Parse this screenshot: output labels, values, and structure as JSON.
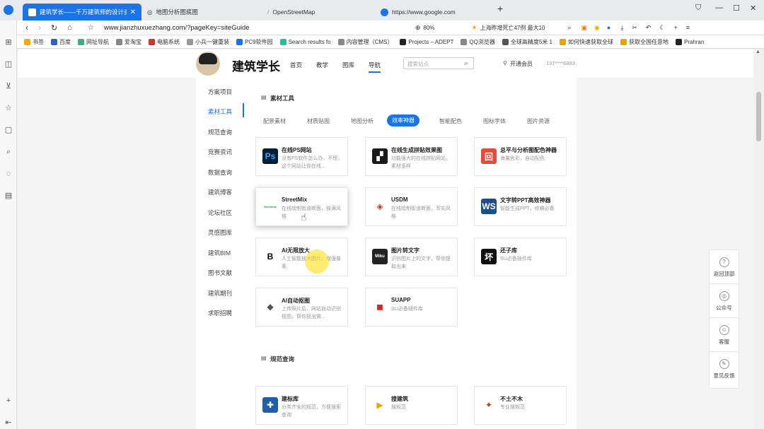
{
  "tabs": [
    {
      "label": "建筑学长——千万建筑师的设计资源",
      "active": true
    },
    {
      "label": "地图分析图底图",
      "active": false
    },
    {
      "label": "OpenStreetMap",
      "active": false
    },
    {
      "label": "https://www.google.com",
      "active": false
    }
  ],
  "new_tab": "+",
  "address": {
    "url": "www.jianzhuxuezhang.com/?pageKey=siteGuide",
    "zoom": "80%",
    "weather": "上海昨增死亡47例 最大10"
  },
  "bookmarks": [
    "书签",
    "百度",
    "网址导航",
    "爱淘宝",
    "电脑系统",
    "小兵一键重装",
    "PC9软件园",
    "Search results fo",
    "内容管理（CMS）",
    "Projects – ADEPT",
    "QQ浏览器",
    "全球高精度5米 1",
    "如何快速获取全球",
    "获取全国任意地",
    "Prahran"
  ],
  "header": {
    "logo": "建筑学长",
    "nav": [
      "首页",
      "教学",
      "图库",
      "导航"
    ],
    "search_placeholder": "搜索站点",
    "vip": "开通会员",
    "phone": "137****6893"
  },
  "sidenav": [
    "方案项目",
    "素材工具",
    "规范查询",
    "竞赛资讯",
    "数据查询",
    "建筑博客",
    "论坛社区",
    "灵感图库",
    "建筑BIM",
    "图书文献",
    "建筑期刊",
    "求职招聘"
  ],
  "sidenav_active": "素材工具",
  "section1": {
    "title": "素材工具",
    "categories": [
      "配景素材",
      "材质贴图",
      "地图分析",
      "效率神器",
      "智能配色",
      "图标字体",
      "图片资源"
    ],
    "active_category": "效率神器",
    "cards": [
      {
        "title": "在线PS网站",
        "desc": "没有PS软件怎么办，不慌，这个网站让你在线...",
        "icon": "Ps",
        "color": "#001e36",
        "fg": "#31a8ff"
      },
      {
        "title": "在线生成拼贴效果图",
        "desc": "功能强大的在线拼贴网站，素材多样",
        "icon": "▞",
        "color": "#1a1a1a",
        "fg": "#ffffff"
      },
      {
        "title": "总平与分析图配色神器",
        "desc": "海量色彩，自动配色",
        "icon": "回",
        "color": "#e8493a",
        "fg": "#ffffff"
      },
      {
        "title": "StreetMix",
        "desc": "在线绘制街道断面，操满风格",
        "icon": "Streetmix",
        "color": "#ffffff",
        "fg": "#2a9d3a"
      },
      {
        "title": "USDM",
        "desc": "在线绘制街道断面，写实风格",
        "icon": "◈",
        "color": "#ffffff",
        "fg": "#c0392b"
      },
      {
        "title": "文字转PPT高效神器",
        "desc": "智能生成PPT，修稿必备",
        "icon": "WS",
        "color": "#1f4e8c",
        "fg": "#ffffff"
      },
      {
        "title": "AI无限放大",
        "desc": "人工智能放大图片，增强像素",
        "icon": "B",
        "color": "#ffffff",
        "fg": "#000000"
      },
      {
        "title": "图片转文字",
        "desc": "识别图片上的文字，帮你提取出来",
        "icon": "Miku",
        "color": "#222222",
        "fg": "#ffffff"
      },
      {
        "title": "还子库",
        "desc": "SU必备插件库",
        "icon": "坏",
        "color": "#111111",
        "fg": "#ffffff"
      },
      {
        "title": "AI自动抠图",
        "desc": "上传照片后，网站自动识别抠图，帮你抠出需...",
        "icon": "◆",
        "color": "#ffffff",
        "fg": "#555555"
      },
      {
        "title": "SUAPP",
        "desc": "SU必备插件库",
        "icon": "◼",
        "color": "#ffffff",
        "fg": "#d9261c"
      }
    ]
  },
  "section2": {
    "title": "规范查询",
    "cards": [
      {
        "title": "建标库",
        "desc": "分类齐全的规范，方便搜索查询",
        "icon": "✚",
        "color": "#1f5fa8",
        "fg": "#ffffff"
      },
      {
        "title": "搜建筑",
        "desc": "搜规范",
        "icon": "▶",
        "color": "#ffffff",
        "fg": "#e6a700"
      },
      {
        "title": "不土不木",
        "desc": "专业搜规范",
        "icon": "✦",
        "color": "#ffffff",
        "fg": "#c0392b"
      }
    ]
  },
  "right_float": [
    "返回顶部",
    "公众号",
    "客服",
    "意见反馈"
  ]
}
